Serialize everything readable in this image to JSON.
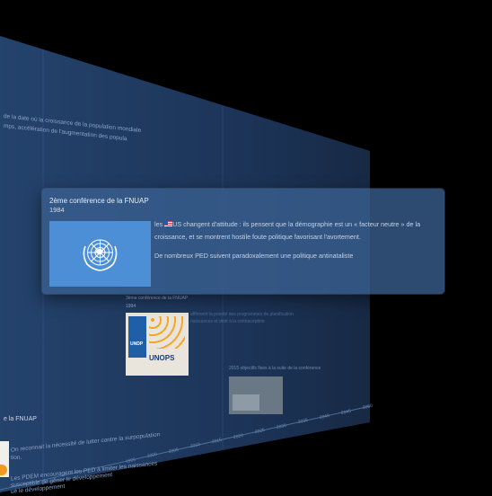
{
  "background": {
    "intro_line_1": "de la date où la croissance de la population mondiale",
    "intro_line_2": "mps, accélération de l'augmentation des popula",
    "entry2_title": "3ème conférence de la FNUAP",
    "entry2_year": "1994",
    "entry2_text_1": "affirment la priorité des programmes de planification",
    "entry2_text_2": "naissances et droit à la contraception",
    "entry2_logo_left": "UNDP",
    "entry2_logo_right": "UNOPS",
    "entry3_text": "2015 objectifs fixés à la suite de la conférence",
    "left_label": "e la FNUAP",
    "left_text_1": "On reconnait la nécessité de lutter contre la surpopulation",
    "left_text_2": "tion.",
    "left_text_3": "Les PDEM encouragent les PED à limiter les naissances",
    "left_text_4": "susceptible de gêner le développement",
    "left_text_5": "ué le développement",
    "years": [
      "1995",
      "2000",
      "2005",
      "2010",
      "2015",
      "2020",
      "2025",
      "2030",
      "2035",
      "2040",
      "2045",
      "2050"
    ]
  },
  "card": {
    "title": "2ème conférence de la FNUAP",
    "year": "1984",
    "text_prefix": "les ",
    "flag_icon": "us-flag-icon",
    "text_main": "US changent d'attitude : ils pensent que la démographie est un « facteur neutre » de la croissance, et se montrent hostile  foute politique favorisant l'avortement.",
    "text_second": "De nombreux PED suivent paradoxalement une politique antinataliste",
    "flag_color": "#4d8fd6"
  }
}
